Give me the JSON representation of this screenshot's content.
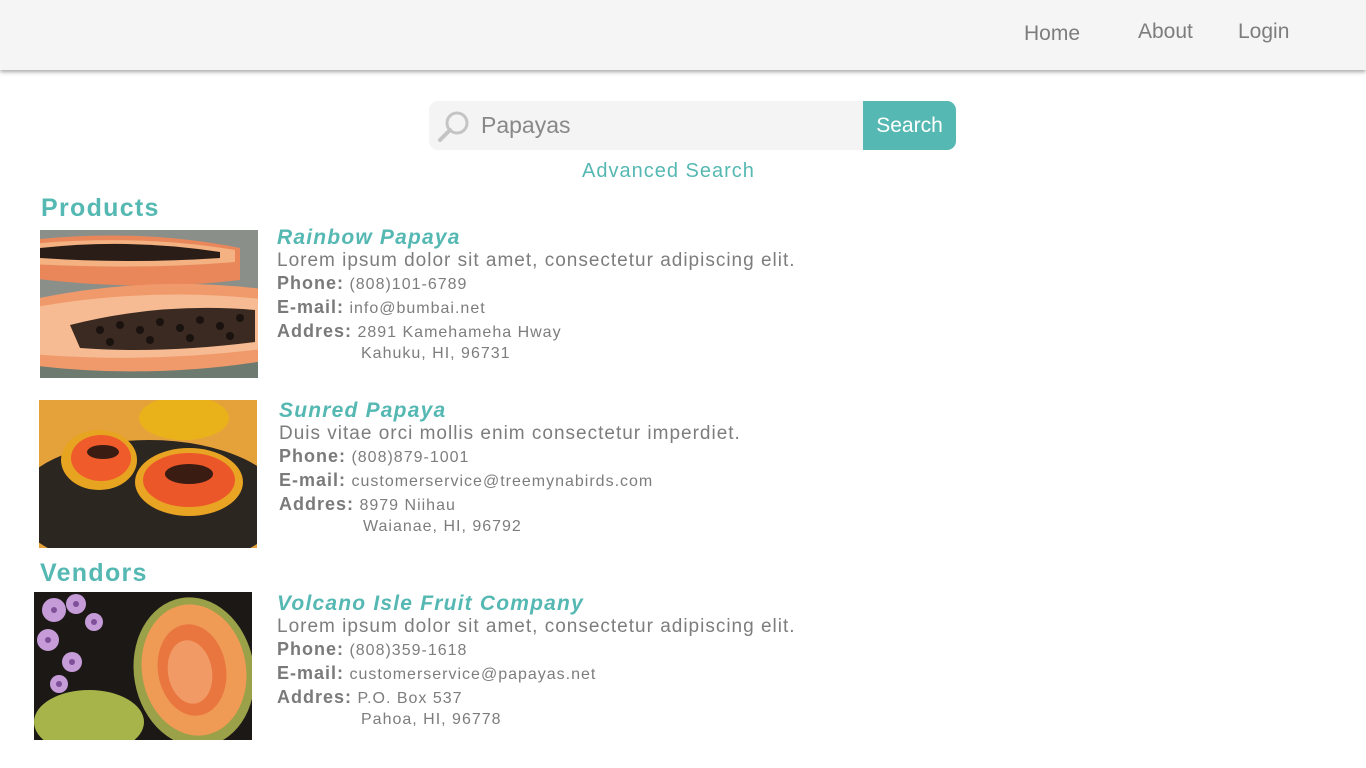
{
  "nav": {
    "home": "Home",
    "about": "About",
    "login": "Login"
  },
  "search": {
    "value": "Papayas",
    "button": "Search",
    "advanced": "Advanced Search"
  },
  "sections": {
    "products": "Products",
    "vendors": "Vendors"
  },
  "labels": {
    "phone": "Phone:",
    "email": "E-mail:",
    "address": "Addres:"
  },
  "products": [
    {
      "name": "Rainbow Papaya",
      "description": "Lorem ipsum dolor sit amet, consectetur adipiscing elit.",
      "phone": "(808)101-6789",
      "email": "info@bumbai.net",
      "address_line1": "2891 Kamehameha Hway",
      "address_line2": "Kahuku, HI, 96731"
    },
    {
      "name": "Sunred Papaya",
      "description": "Duis vitae orci mollis enim consectetur imperdiet.",
      "phone": "(808)879-1001",
      "email": "customerservice@treemynabirds.com",
      "address_line1": "8979 Niihau",
      "address_line2": "Waianae, HI, 96792"
    }
  ],
  "vendors": [
    {
      "name": "Volcano Isle Fruit Company",
      "description": "Lorem ipsum dolor sit amet, consectetur adipiscing elit.",
      "phone": "(808)359-1618",
      "email": "customerservice@papayas.net",
      "address_line1": "P.O. Box 537",
      "address_line2": "Pahoa, HI, 96778"
    }
  ],
  "colors": {
    "accent": "#55b8b2",
    "text": "#7d7d7d",
    "header_bg": "#f5f5f5"
  }
}
